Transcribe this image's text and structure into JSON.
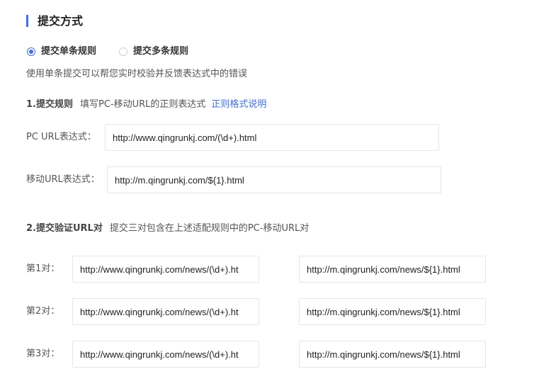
{
  "section": {
    "title": "提交方式"
  },
  "mode": {
    "options": [
      {
        "label": "提交单条规则",
        "selected": true
      },
      {
        "label": "提交多条规则",
        "selected": false
      }
    ],
    "description": "使用单条提交可以帮您实时校验并反馈表达式中的错误"
  },
  "rule": {
    "heading": "1.提交规则",
    "hint": "填写PC-移动URL的正则表达式",
    "link": "正则格式说明",
    "pc_label": "PC  URL表达式：",
    "pc_value": "http://www.qingrunkj.com/(\\d+).html",
    "mobile_label": "移动URL表达式：",
    "mobile_value": "http://m.qingrunkj.com/${1}.html"
  },
  "verify": {
    "heading": "2.提交验证URL对",
    "hint": "提交三对包含在上述适配规则中的PC-移动URL对",
    "pairs": [
      {
        "label": "第1对：",
        "pc": "http://www.qingrunkj.com/news/(\\d+).ht",
        "mobile": "http://m.qingrunkj.com/news/${1}.html"
      },
      {
        "label": "第2对：",
        "pc": "http://www.qingrunkj.com/news/(\\d+).ht",
        "mobile": "http://m.qingrunkj.com/news/${1}.html"
      },
      {
        "label": "第3对：",
        "pc": "http://www.qingrunkj.com/news/(\\d+).ht",
        "mobile": "http://m.qingrunkj.com/news/${1}.html"
      }
    ]
  },
  "colors": {
    "accent": "#3c6ef0",
    "border": "#e4e6eb",
    "text": "#333333"
  }
}
